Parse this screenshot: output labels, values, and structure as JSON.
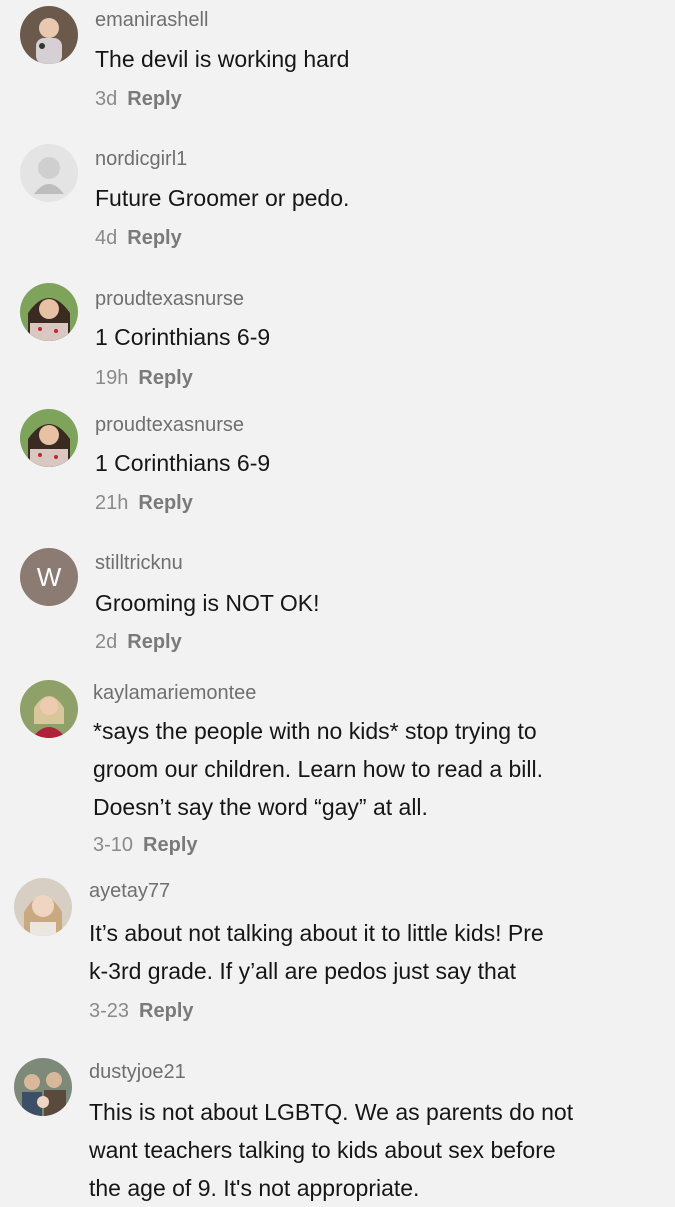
{
  "comments": [
    {
      "username": "emanirashell",
      "lines": [
        "The devil is working hard"
      ],
      "time": "3d",
      "reply_label": "Reply",
      "avatar": "photo-avatar"
    },
    {
      "username": "nordicgirl1",
      "lines": [
        "Future Groomer or pedo."
      ],
      "time": "4d",
      "reply_label": "Reply",
      "avatar": "photo-avatar"
    },
    {
      "username": "proudtexasnurse",
      "lines": [
        "1 Corinthians 6-9"
      ],
      "time": "19h",
      "reply_label": "Reply",
      "avatar": "photo-avatar"
    },
    {
      "username": "proudtexasnurse",
      "lines": [
        "1 Corinthians 6-9"
      ],
      "time": "21h",
      "reply_label": "Reply",
      "avatar": "photo-avatar"
    },
    {
      "username": "stilltricknu",
      "lines": [
        "Grooming is NOT OK!"
      ],
      "time": "2d",
      "reply_label": "Reply",
      "avatar_letter": "W",
      "avatar_color": "#8b7b72"
    },
    {
      "username": "kaylamariemontee",
      "lines": [
        "*says the people with no kids* stop trying to",
        "groom our children. Learn how to read a bill.",
        "Doesn’t say the word “gay” at all."
      ],
      "time": "3-10",
      "reply_label": "Reply",
      "avatar": "photo-avatar"
    },
    {
      "username": "ayetay77",
      "lines": [
        "It’s about not talking about it to little kids! Pre",
        "k-3rd grade. If y’all are pedos just say that"
      ],
      "time": "3-23",
      "reply_label": "Reply",
      "avatar": "photo-avatar"
    },
    {
      "username": "dustyjoe21",
      "lines": [
        "This is not about LGBTQ. We as parents do not",
        "want teachers talking to kids about sex before",
        "the age of 9. It's not appropriate."
      ],
      "time": "",
      "reply_label": "",
      "avatar": "photo-avatar"
    }
  ]
}
